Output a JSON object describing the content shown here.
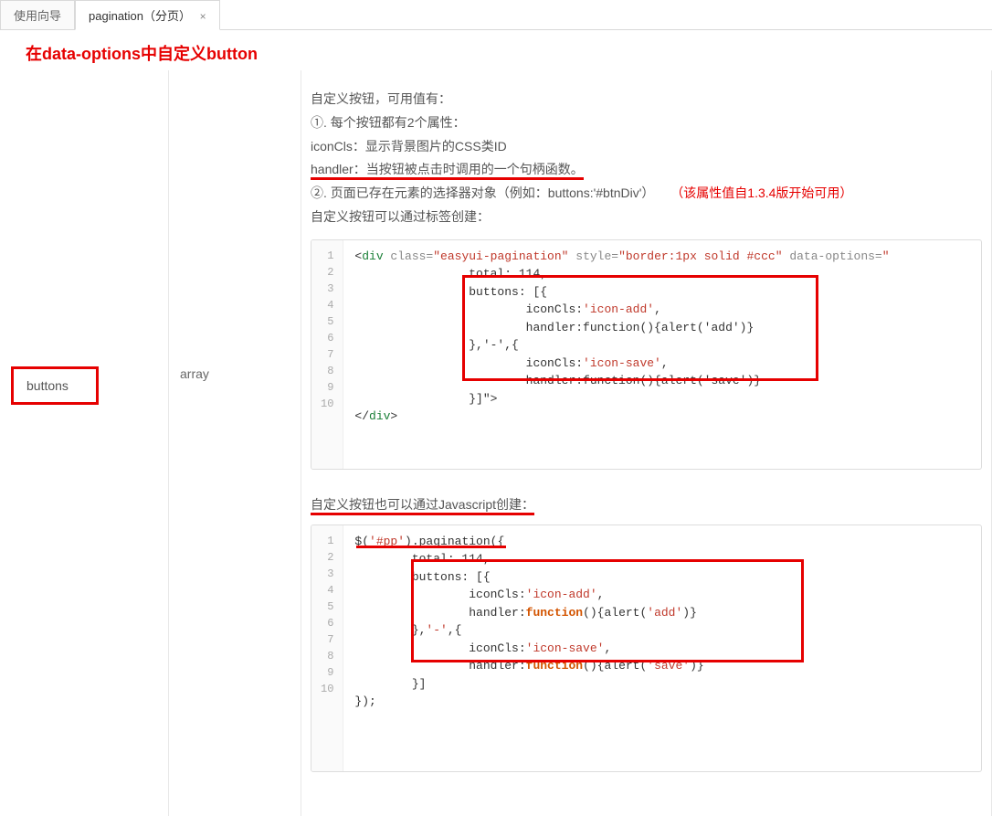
{
  "tabs": {
    "inactive_label": "使用向导",
    "active_label": "pagination（分页）",
    "close_glyph": "×"
  },
  "heading": "在data-options中自定义button",
  "prop": {
    "name": "buttons",
    "type": "array"
  },
  "desc": {
    "line1": "自定义按钮，可用值有：",
    "line2_prefix": "①. 每个按钮都有2个属性：",
    "line3": "iconCls：显示背景图片的CSS类ID",
    "line4": "handler：当按钮被点击时调用的一个句柄函数。",
    "line5": "②. 页面已存在元素的选择器对象（例如：buttons:'#btnDiv'）",
    "line5_note": "（该属性值自1.3.4版开始可用）",
    "line6": "自定义按钮可以通过标签创建："
  },
  "code1": {
    "gutter": "1\n2\n3\n4\n5\n6\n7\n8\n9\n10",
    "l1_open": "<",
    "l1_tag": "div",
    "l1_attr1": " class=",
    "l1_str1": "\"easyui-pagination\"",
    "l1_attr2": " style=",
    "l1_str2": "\"border:1px solid #ccc\"",
    "l1_attr3": " data-options=",
    "l1_end": "\"",
    "l2": "                total: 114,",
    "l3": "                buttons: [{",
    "l4_a": "                        iconCls:",
    "l4_b": "'icon-add'",
    "l4_c": ",",
    "l5": "                        handler:function(){alert('add')}",
    "l6": "                },'-',{",
    "l7_a": "                        iconCls:",
    "l7_b": "'icon-save'",
    "l7_c": ",",
    "l8": "                        handler:function(){alert('save')}",
    "l9": "                }]\">",
    "l10_open": "</",
    "l10_tag": "div",
    "l10_close": ">"
  },
  "section2_title": "自定义按钮也可以通过Javascript创建：",
  "code2": {
    "gutter": "1\n2\n3\n4\n5\n6\n7\n8\n9\n10",
    "l1_a": "$(",
    "l1_b": "'#pp'",
    "l1_c": ").pagination({",
    "l2": "        total: 114,",
    "l3": "        buttons: [{",
    "l4_a": "                iconCls:",
    "l4_b": "'icon-add'",
    "l4_c": ",",
    "l5_a": "                handler:",
    "l5_b": "function",
    "l5_c": "(){alert(",
    "l5_d": "'add'",
    "l5_e": ")}",
    "l6_a": "        },",
    "l6_b": "'-'",
    "l6_c": ",{",
    "l7_a": "                iconCls:",
    "l7_b": "'icon-save'",
    "l7_c": ",",
    "l8_a": "                handler:",
    "l8_b": "function",
    "l8_c": "(){alert(",
    "l8_d": "'save'",
    "l8_e": ")}",
    "l9": "        }]",
    "l10": "});"
  }
}
